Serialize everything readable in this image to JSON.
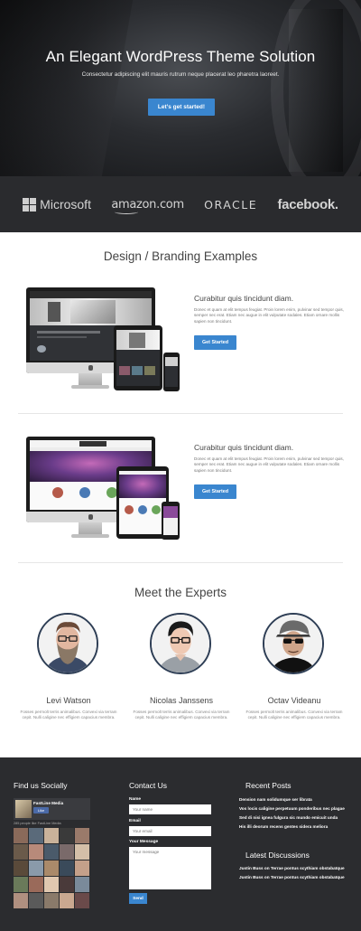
{
  "hero": {
    "title": "An Elegant WordPress Theme Solution",
    "subtitle": "Consectetur adipiscing elit mauris rutrum neque placerat leo pharetra laoreet.",
    "cta_label": "Let’s get started!"
  },
  "logos": {
    "microsoft": "Microsoft",
    "amazon": "amazon.com",
    "oracle": "ORACLE",
    "facebook": "facebook."
  },
  "design": {
    "title": "Design / Branding Examples",
    "items": [
      {
        "heading": "Curabitur quis tincidunt diam.",
        "text": "Donec et quam at elit tempus feugiat. Proin lorem enim, pulvinar sed tempor quis, semper nec erat. Etiam nec augue in elit vulputate sodales. Etiam ornare mollis sapien non tincidunt.",
        "button": "Get Started"
      },
      {
        "heading": "Curabitur quis tincidunt diam.",
        "text": "Donec et quam at elit tempus feugiat. Proin lorem enim, pulvinar sed tempor quis, semper nec erat. Etiam nec augue in elit vulputate sodales. Etiam ornare mollis sapien non tincidunt.",
        "button": "Get Started"
      }
    ]
  },
  "experts": {
    "title": "Meet the Experts",
    "people": [
      {
        "name": "Levi Watson",
        "bio": "Fosses permolt terris animalibus. Convexi via terram cepit. Nulli caligine nec effigiem capacius membra."
      },
      {
        "name": "Nicolas Janssens",
        "bio": "Fosses permolt terris animalibus. Convexi via terram cepit. Nulli caligine nec effigiem capacius membra."
      },
      {
        "name": "Octav Videanu",
        "bio": "Fosses permolt terris animalibus. Convexi via terram cepit. Nulli caligine nec effigiem capacius membra."
      }
    ]
  },
  "footer": {
    "social_title": "Find us Socially",
    "fb_page_name": "FastLine Media",
    "fb_like": "Like",
    "fb_count": "285 people like FastLine Media",
    "contact_title": "Contact Us",
    "name_label": "Name",
    "name_placeholder": "Your name",
    "email_label": "Email",
    "email_placeholder": "Your email",
    "message_label": "Your Message",
    "message_placeholder": "Your message",
    "send_label": "Send",
    "recent_title": "Recent Posts",
    "recent_posts": [
      "Dension nam solidumque ser librata",
      "Vos locis caligine perpetuum ponderibus nec plagae",
      "Sed di nisi ignea fulgura sic mundo emicuit unda",
      "His illi deorum recens gentes sidera meliora"
    ],
    "discussions_title": "Latest Discussions",
    "discussions": [
      "Justin Buss on Terrae pontus scythiam obstabatque",
      "Justin Buss on Terrae pontus scythiam obstabatque"
    ]
  },
  "colors": {
    "accent": "#3a86cf",
    "footer_bg": "#2b2c2f",
    "logobar_bg": "#2a2b2e"
  }
}
